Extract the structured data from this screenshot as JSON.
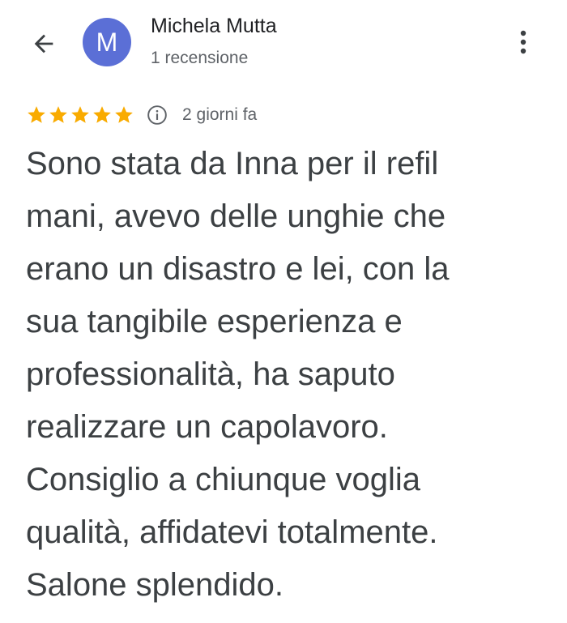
{
  "header": {
    "back_icon": "arrow-left-icon",
    "avatar_letter": "M",
    "avatar_color": "#5b6fd6",
    "reviewer_name": "Michela Mutta",
    "review_count": "1 recensione",
    "more_icon": "more-vert-icon"
  },
  "review": {
    "rating": 5,
    "rating_max": 5,
    "star_color": "#f9ab00",
    "info_icon": "info-icon",
    "time_ago": "2 giorni fa",
    "text": "Sono stata da Inna per il refil\nmani, avevo delle unghie che\nerano un disastro e lei, con la\nsua tangibile esperienza e\nprofessionalità,  ha saputo\nrealizzare un capolavoro.\nConsiglio a chiunque voglia\nqualità, affidatevi totalmente.\nSalone splendido."
  }
}
